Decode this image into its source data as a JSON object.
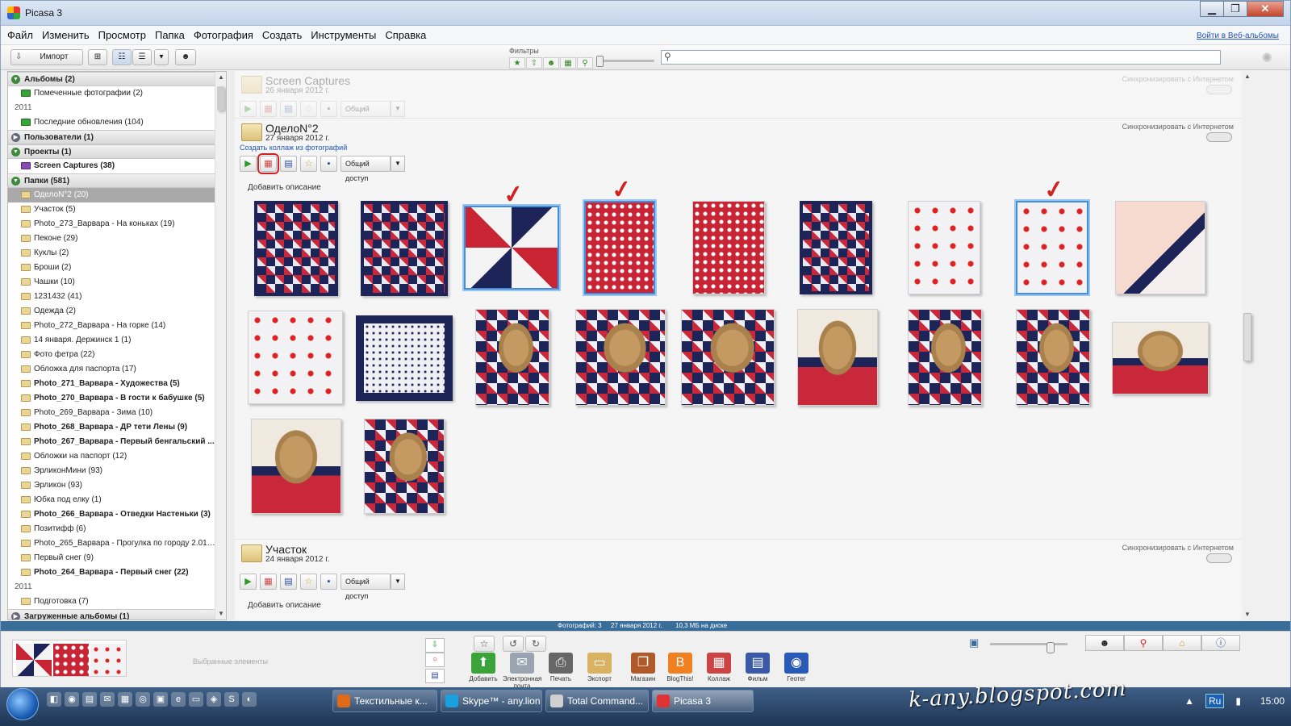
{
  "window": {
    "title": "Picasa 3",
    "min": "▁",
    "max": "❐",
    "close": "✕"
  },
  "menu": {
    "items": [
      "Файл",
      "Изменить",
      "Просмотр",
      "Папка",
      "Фотография",
      "Создать",
      "Инструменты",
      "Справка"
    ],
    "web_link": "Войти в Веб-альбомы"
  },
  "toolbar": {
    "import_label": "Импорт",
    "filters_label": "Фильтры",
    "search_placeholder": ""
  },
  "sidebar": {
    "rows": [
      {
        "kind": "hdr",
        "open": true,
        "label": "Альбомы (2)"
      },
      {
        "kind": "item",
        "icon": "green",
        "label": "Помеченные фотографии (2)"
      },
      {
        "kind": "year",
        "label": "2011"
      },
      {
        "kind": "item",
        "icon": "green",
        "label": "Последние обновления (104)"
      },
      {
        "kind": "hdr",
        "open": false,
        "label": "Пользователи (1)"
      },
      {
        "kind": "hdr",
        "open": true,
        "label": "Проекты (1)"
      },
      {
        "kind": "item",
        "icon": "purple",
        "bold": true,
        "label": "Screen Captures (38)"
      },
      {
        "kind": "hdr",
        "open": true,
        "label": "Папки (581)"
      },
      {
        "kind": "item",
        "sel": true,
        "label": "ОделоN°2 (20)"
      },
      {
        "kind": "item",
        "label": "Участок (5)"
      },
      {
        "kind": "item",
        "label": "Photo_273_Варвара - На коньках (19)"
      },
      {
        "kind": "item",
        "label": "Пеконе (29)"
      },
      {
        "kind": "item",
        "label": "Куклы (2)"
      },
      {
        "kind": "item",
        "label": "Броши (2)"
      },
      {
        "kind": "item",
        "label": "Чашки (10)"
      },
      {
        "kind": "item",
        "label": "1231432 (41)"
      },
      {
        "kind": "item",
        "label": "Одежда (2)"
      },
      {
        "kind": "item",
        "label": "Photo_272_Варвара - На горке (14)"
      },
      {
        "kind": "item",
        "label": "14 января. Держинск 1 (1)"
      },
      {
        "kind": "item",
        "label": "Фото фетра (22)"
      },
      {
        "kind": "item",
        "label": "Обложка для паспорта (17)"
      },
      {
        "kind": "item",
        "bold": true,
        "label": "Photo_271_Варвара - Художества (5)"
      },
      {
        "kind": "item",
        "bold": true,
        "label": "Photo_270_Варвара - В гости к бабушке (5)"
      },
      {
        "kind": "item",
        "label": "Photo_269_Варвара - Зима (10)"
      },
      {
        "kind": "item",
        "bold": true,
        "label": "Photo_268_Варвара - ДР тети Лены (9)"
      },
      {
        "kind": "item",
        "bold": true,
        "label": "Photo_267_Варвара - Первый бенгальский ..."
      },
      {
        "kind": "item",
        "label": "Обложки на паспорт (12)"
      },
      {
        "kind": "item",
        "label": "ЭрликонМини (93)"
      },
      {
        "kind": "item",
        "label": "Эрликон (93)"
      },
      {
        "kind": "item",
        "label": "Юбка под елку (1)"
      },
      {
        "kind": "item",
        "bold": true,
        "label": "Photo_266_Варвара - Отведки Настеньки (3)"
      },
      {
        "kind": "item",
        "label": "Позитифф (6)"
      },
      {
        "kind": "item",
        "label": "Photo_265_Варвара - Прогулка по городу 2.01.2..."
      },
      {
        "kind": "item",
        "label": "Первый снег (9)"
      },
      {
        "kind": "item",
        "bold": true,
        "label": "Photo_264_Варвара - Первый снег (22)"
      },
      {
        "kind": "year",
        "label": "2011"
      },
      {
        "kind": "item",
        "label": "Подготовка (7)"
      },
      {
        "kind": "hdr",
        "open": false,
        "label": "Загруженные альбомы (1)"
      }
    ]
  },
  "sections": {
    "screen": {
      "name": "Screen Captures",
      "date": "26 января 2012 г.",
      "sync": "Синхронизировать с Интернетом",
      "share": "Общий доступ"
    },
    "odelo": {
      "name": "ОделоN°2",
      "date": "27 января 2012 г.",
      "link": "Создать коллаж из фотографий",
      "sync": "Синхронизировать с Интернетом",
      "share": "Общий доступ",
      "add_desc": "Добавить описание"
    },
    "uchastok": {
      "name": "Участок",
      "date": "24 января 2012 г.",
      "sync": "Синхронизировать с Интернетом",
      "share": "Общий доступ",
      "add_desc": "Добавить описание"
    }
  },
  "photos": [
    {
      "style": "t-quilt",
      "selected": false,
      "checked": false
    },
    {
      "style": "t-quilt",
      "selected": false,
      "checked": false
    },
    {
      "style": "t-pin",
      "selected": true,
      "checked": true
    },
    {
      "style": "t-red",
      "selected": true,
      "checked": true
    },
    {
      "style": "t-red",
      "selected": false,
      "checked": false
    },
    {
      "style": "t-quilt",
      "selected": false,
      "checked": false
    },
    {
      "style": "t-white",
      "selected": false,
      "checked": false
    },
    {
      "style": "t-white",
      "selected": true,
      "checked": true
    },
    {
      "style": "t-corner",
      "selected": false,
      "checked": false
    },
    {
      "style": "t-white",
      "selected": false,
      "checked": false
    },
    {
      "style": "t-pillow",
      "selected": false,
      "checked": false
    },
    {
      "style": "t-bear",
      "selected": false,
      "checked": false
    },
    {
      "style": "t-bear",
      "selected": false,
      "checked": false
    },
    {
      "style": "t-bear",
      "selected": false,
      "checked": false
    },
    {
      "style": "t-bear2",
      "selected": false,
      "checked": false
    },
    {
      "style": "t-bear",
      "selected": false,
      "checked": false
    },
    {
      "style": "t-bear",
      "selected": false,
      "checked": false
    },
    {
      "style": "t-bear2",
      "selected": false,
      "checked": false
    },
    {
      "style": "t-bear2",
      "selected": false,
      "checked": false
    },
    {
      "style": "t-bear",
      "selected": false,
      "checked": false
    }
  ],
  "status": {
    "count": "Фотографий: 3",
    "date": "27 января 2012 г.",
    "size": "10,3 МБ на диске"
  },
  "tray": {
    "label": "Выбранные элементы"
  },
  "actions": [
    {
      "label": "Добавить",
      "icon": "⬆",
      "color": "#3aa33a"
    },
    {
      "label": "Электронная почта",
      "icon": "✉",
      "color": "#9aa3b0"
    },
    {
      "label": "Печать",
      "icon": "⎙",
      "color": "#666"
    },
    {
      "label": "Экспорт",
      "icon": "▭",
      "color": "#d8b260"
    },
    {
      "label": "Магазин",
      "icon": "❐",
      "color": "#b05a2a"
    },
    {
      "label": "BlogThis!",
      "icon": "B",
      "color": "#f08020"
    },
    {
      "label": "Коллаж",
      "icon": "▦",
      "color": "#c44"
    },
    {
      "label": "Фильм",
      "icon": "▤",
      "color": "#3a5aa8"
    },
    {
      "label": "Геотег",
      "icon": "◉",
      "color": "#2a5ab8"
    }
  ],
  "taskbar": {
    "tasks": [
      {
        "label": "Текстильные к...",
        "color": "#e06a1a"
      },
      {
        "label": "Skype™ - any.lion",
        "color": "#1aa0e0"
      },
      {
        "label": "Total Command...",
        "color": "#d0d0d0"
      },
      {
        "label": "Picasa 3",
        "color": "#e03333"
      }
    ],
    "lang": "Ru",
    "clock": "15:00"
  },
  "watermark": "k-any.blogspot.com"
}
